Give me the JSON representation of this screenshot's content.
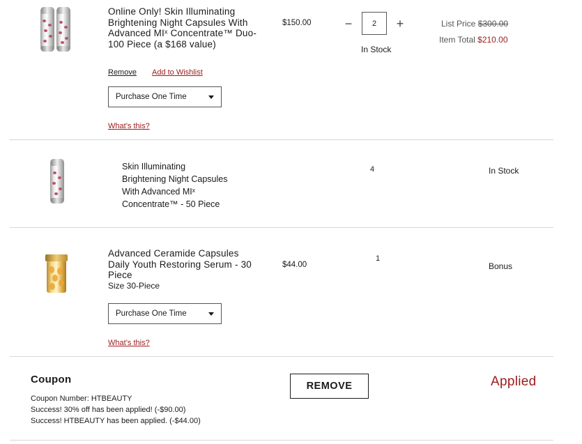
{
  "items": [
    {
      "title": "Online Only! Skin Illuminating Brightening Night Capsules With Advanced MIˣ Concentrate™ Duo-100 Piece (a $168 value)",
      "price": "$150.00",
      "quantity": "2",
      "qty_minus": "−",
      "qty_plus": "+",
      "stock": "In Stock",
      "list_price_label": "List Price",
      "list_price": "$300.00",
      "item_total_label": "Item Total",
      "item_total": "$210.00",
      "remove_label": "Remove",
      "wishlist_label": "Add to Wishlist",
      "purchase_option": "Purchase One Time",
      "whats_this": "What’s this?"
    },
    {
      "title": "Skin Illuminating Brightening Night Capsules With Advanced MIˣ Concentrate™ - 50 Piece",
      "quantity": "4",
      "stock": "In Stock"
    },
    {
      "title": "Advanced Ceramide Capsules Daily Youth Restoring Serum - 30 Piece",
      "size": "Size 30-Piece",
      "price": "$44.00",
      "quantity": "1",
      "stock": "Bonus",
      "purchase_option": "Purchase One Time",
      "whats_this": "What’s this?"
    }
  ],
  "coupon": {
    "heading": "Coupon",
    "number_line": "Coupon Number: HTBEAUTY",
    "success_1": "Success! 30% off has been applied! (-$90.00)",
    "success_2": "Success! HTBEAUTY has been applied. (-$44.00)",
    "remove_label": "REMOVE",
    "status": "Applied"
  },
  "icons": {
    "caret": "chevron-down-icon"
  },
  "colors": {
    "accent_red": "#9b1b1b",
    "divider": "#d6d6d6"
  }
}
